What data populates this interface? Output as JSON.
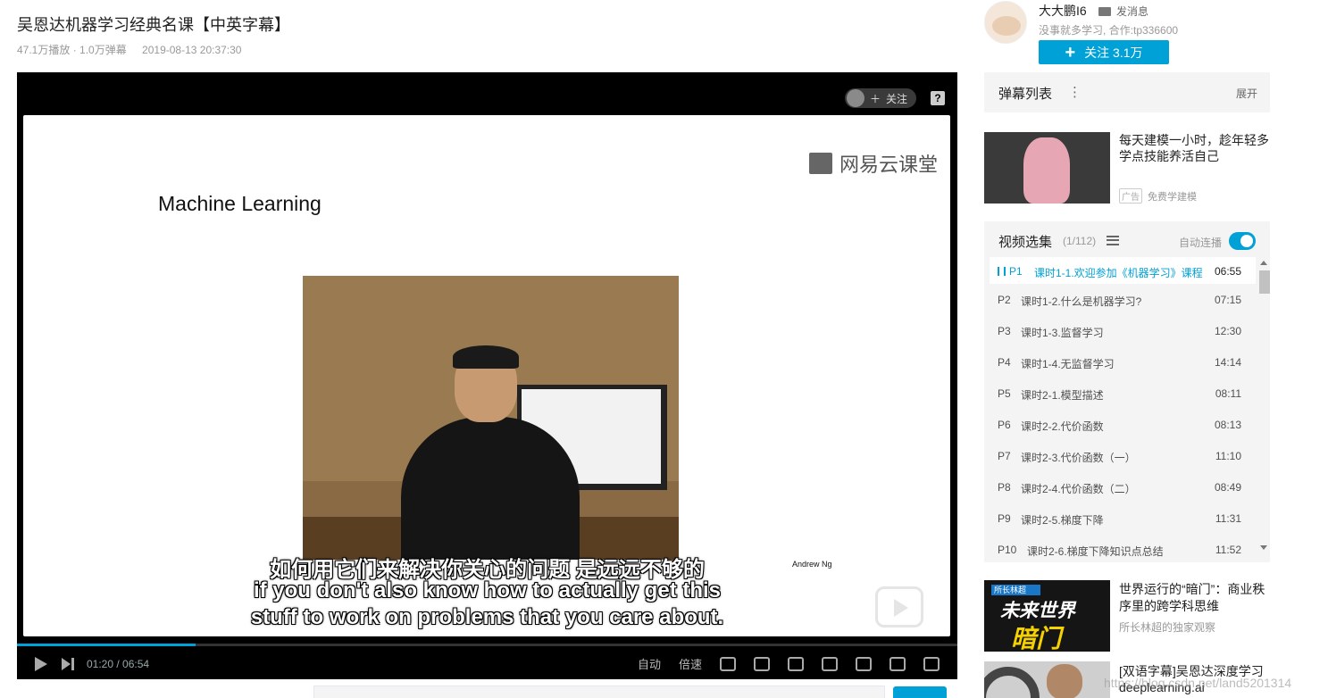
{
  "video": {
    "title": "吴恩达机器学习经典名课【中英字幕】",
    "views": "47.1万播放 · 1.0万弹幕",
    "date": "2019-08-13 20:37:30"
  },
  "player": {
    "follow_label": "关注",
    "slide_brand": "网易云课堂",
    "slide_heading": "Machine Learning",
    "speaker_name": "Andrew Ng",
    "subtitle_zh": "如何用它们来解决你关心的问题 是远远不够的",
    "subtitle_en_1": "if you don't also know how to actually get this",
    "subtitle_en_2": "stuff to work on problems that you care about.",
    "time": "01:20 / 06:54",
    "progress": 0.19,
    "auto_label": "自动",
    "speed_label": "倍速"
  },
  "uploader": {
    "name": "大大鹏I6",
    "message_label": "发消息",
    "description": "没事就多学习, 合作:tp336600",
    "follow_label": "关注 3.1万"
  },
  "danmaku": {
    "title": "弹幕列表",
    "more_glyph": "⋮",
    "expand_label": "展开"
  },
  "ad": {
    "title": "每天建模一小时，趁年轻多学点技能养活自己",
    "badge": "广告",
    "source": "免费学建模"
  },
  "playlist": {
    "title": "视频选集",
    "count": "(1/112)",
    "autoplay_label": "自动连播",
    "items": [
      {
        "p": "P1",
        "title": "课时1-1.欢迎参加《机器学习》课程",
        "duration": "06:55"
      },
      {
        "p": "P2",
        "title": "课时1-2.什么是机器学习?",
        "duration": "07:15"
      },
      {
        "p": "P3",
        "title": "课时1-3.监督学习",
        "duration": "12:30"
      },
      {
        "p": "P4",
        "title": "课时1-4.无监督学习",
        "duration": "14:14"
      },
      {
        "p": "P5",
        "title": "课时2-1.模型描述",
        "duration": "08:11"
      },
      {
        "p": "P6",
        "title": "课时2-2.代价函数",
        "duration": "08:13"
      },
      {
        "p": "P7",
        "title": "课时2-3.代价函数（一）",
        "duration": "11:10"
      },
      {
        "p": "P8",
        "title": "课时2-4.代价函数（二）",
        "duration": "08:49"
      },
      {
        "p": "P9",
        "title": "课时2-5.梯度下降",
        "duration": "11:31"
      },
      {
        "p": "P10",
        "title": "课时2-6.梯度下降知识点总结",
        "duration": "11:52"
      }
    ]
  },
  "recommend": [
    {
      "title": "世界运行的“暗门”：商业秩序里的跨学科思维",
      "author": "所长林超的独家观察",
      "thumb_tag": "所长林超",
      "thumb_line1": "未来世界",
      "thumb_line2": "暗门"
    },
    {
      "title": "[双语字幕]吴恩达深度学习deeplearning.ai"
    }
  ],
  "watermark": "https://blog.csdn.net/land5201314",
  "colors": {
    "accent": "#00a1d6",
    "text": "#212121",
    "muted": "#999999"
  }
}
